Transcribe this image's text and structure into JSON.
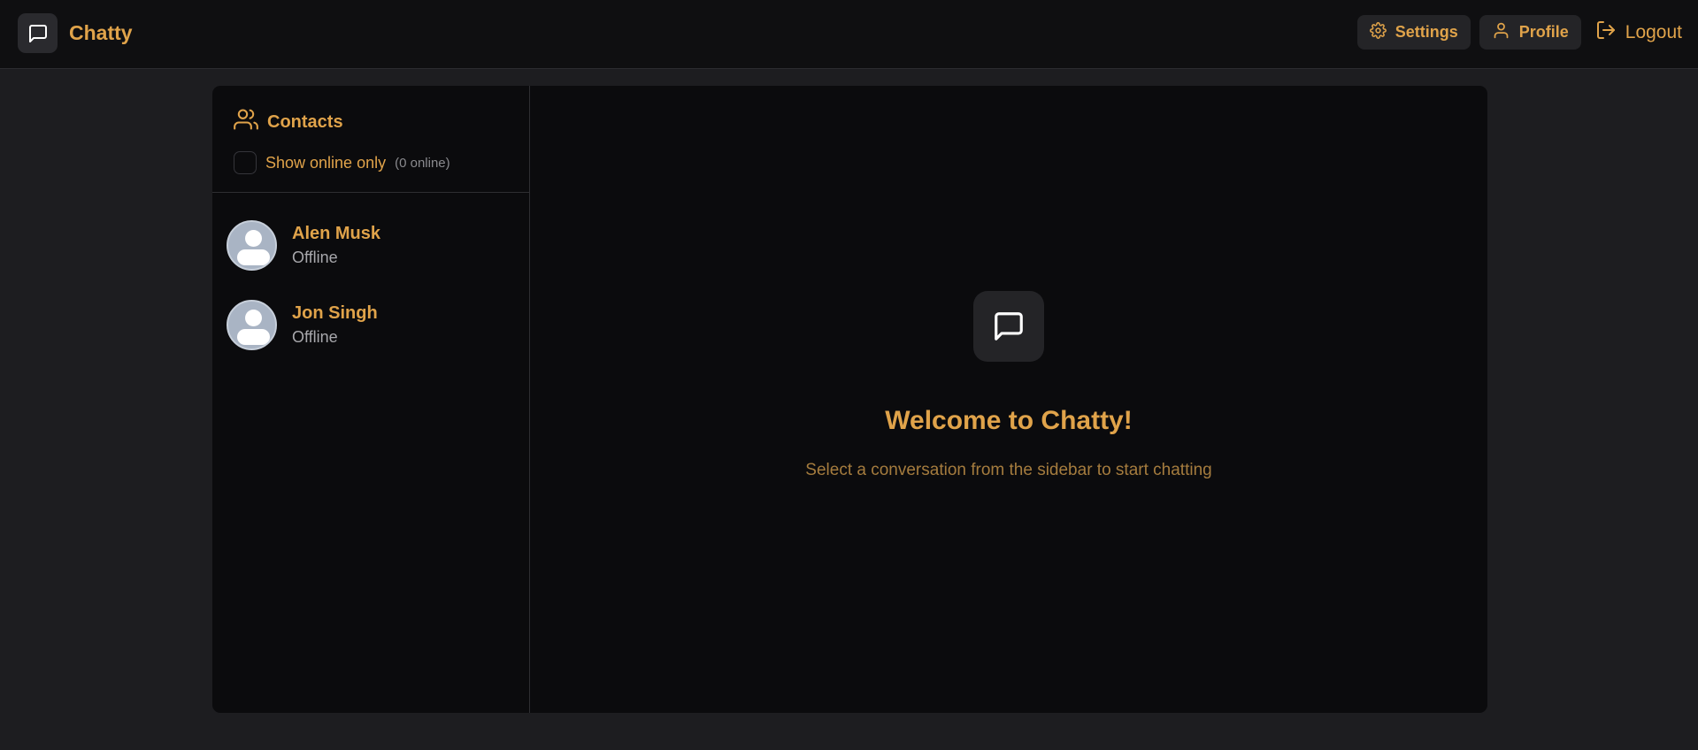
{
  "header": {
    "brand": "Chatty",
    "nav": {
      "settings": "Settings",
      "profile": "Profile",
      "logout": "Logout"
    }
  },
  "sidebar": {
    "title": "Contacts",
    "filter_label": "Show online only",
    "online_count": "(0 online)",
    "contacts": [
      {
        "name": "Alen Musk",
        "status": "Offline"
      },
      {
        "name": "Jon Singh",
        "status": "Offline"
      }
    ]
  },
  "main": {
    "welcome_title": "Welcome to Chatty!",
    "welcome_subtitle": "Select a conversation from the sidebar to start chatting"
  },
  "colors": {
    "accent": "#e0a34a",
    "background": "#1d1d20",
    "panel": "#0b0b0d"
  },
  "icons": {
    "brand": "message-square-icon",
    "settings": "gear-icon",
    "profile": "user-icon",
    "logout": "logout-icon",
    "contacts": "users-icon"
  }
}
